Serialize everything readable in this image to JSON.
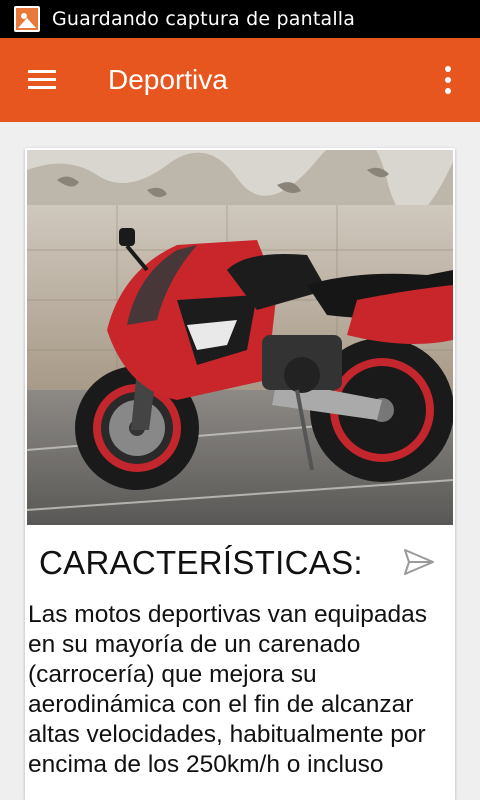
{
  "status_bar": {
    "icon": "image-icon",
    "message": "Guardando captura de pantalla"
  },
  "app_bar": {
    "menu_icon": "hamburger-menu-icon",
    "title": "Deportiva",
    "overflow_icon": "more-vert-icon",
    "color": "#e8561f"
  },
  "card": {
    "image_alt": "motorcycle-photo",
    "title": "CARACTERÍSTICAS:",
    "share_icon": "send-icon",
    "body": "Las motos deportivas van equipadas en su mayoría de un carenado (carrocería) que mejora su aerodinámica con el fin de alcanzar altas velocidades, habitualmente por encima de los 250km/h o incluso"
  }
}
